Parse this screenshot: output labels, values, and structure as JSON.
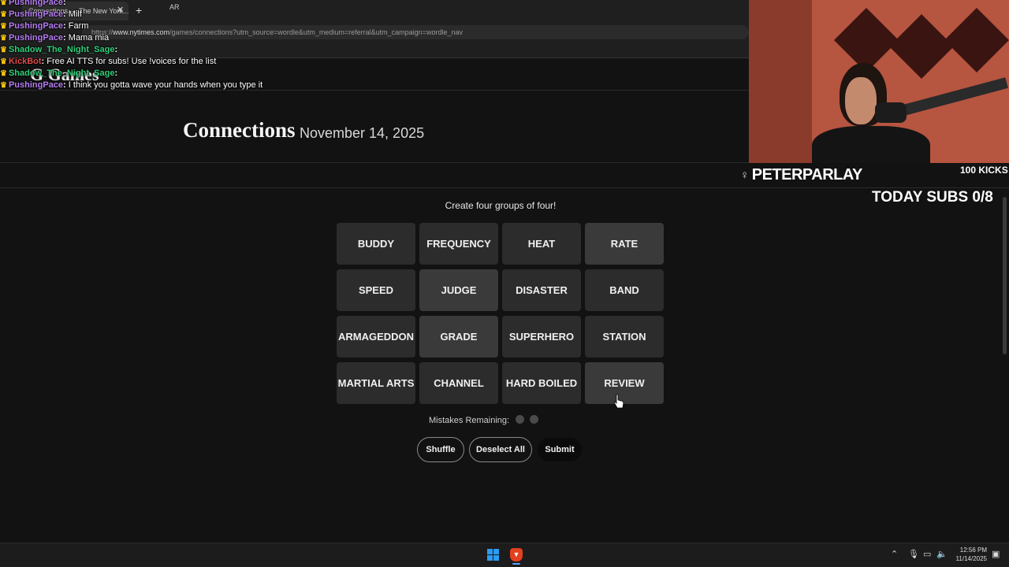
{
  "browser": {
    "tab_title": "Connections — The New York...",
    "tab_close": "✕",
    "new_tab": "+",
    "url_prefix": "https://",
    "url_host": "www.nytimes.com",
    "url_path": "/games/connections?utm_source=wordle&utm_medium=referral&utm_campaign=wordle_nav",
    "bookmark_ar": "AR"
  },
  "nyt": {
    "logo": "G Games",
    "title": "Connections",
    "date": "November 14, 2025",
    "instructions": "Create four groups of four!",
    "tiles": [
      {
        "label": "BUDDY",
        "selected": false
      },
      {
        "label": "FREQUENCY",
        "selected": false
      },
      {
        "label": "HEAT",
        "selected": false
      },
      {
        "label": "RATE",
        "selected": true
      },
      {
        "label": "SPEED",
        "selected": false
      },
      {
        "label": "JUDGE",
        "selected": true
      },
      {
        "label": "DISASTER",
        "selected": false
      },
      {
        "label": "BAND",
        "selected": false
      },
      {
        "label": "ARMAGEDDON",
        "selected": false
      },
      {
        "label": "GRADE",
        "selected": true
      },
      {
        "label": "SUPERHERO",
        "selected": false
      },
      {
        "label": "STATION",
        "selected": false
      },
      {
        "label": "MARTIAL ARTS",
        "selected": false
      },
      {
        "label": "CHANNEL",
        "selected": false
      },
      {
        "label": "HARD BOILED",
        "selected": false
      },
      {
        "label": "REVIEW",
        "selected": true
      }
    ],
    "mistakes_label": "Mistakes Remaining:",
    "mistakes_remaining": 2,
    "buttons": {
      "shuffle": "Shuffle",
      "deselect": "Deselect All",
      "submit": "Submit"
    }
  },
  "stream": {
    "streamer_name": "PETERPARLAY",
    "kicks": "100 KICKS",
    "subs": "TODAY SUBS 0/8"
  },
  "chat": [
    {
      "user": "PushingPace",
      "message": "",
      "color": "#b57cf2"
    },
    {
      "user": "PushingPace",
      "message": "Milf",
      "color": "#b57cf2"
    },
    {
      "user": "PushingPace",
      "message": "Farm",
      "color": "#b57cf2"
    },
    {
      "user": "PushingPace",
      "message": "Mama mia",
      "color": "#b57cf2"
    },
    {
      "user": "Shadow_The_Night_Sage",
      "message": "",
      "color": "#2fcf7a"
    },
    {
      "user": "KickBot",
      "message": "Free AI TTS for subs! Use !voices for the list",
      "color": "#e04b4b"
    },
    {
      "user": "Shadow_The_Night_Sage",
      "message": "",
      "color": "#2fcf7a"
    },
    {
      "user": "PushingPace",
      "message": "I think you gotta wave your hands when you type it",
      "color": "#b57cf2"
    }
  ],
  "taskbar": {
    "time": "12:56 PM",
    "date": "11/14/2025"
  }
}
